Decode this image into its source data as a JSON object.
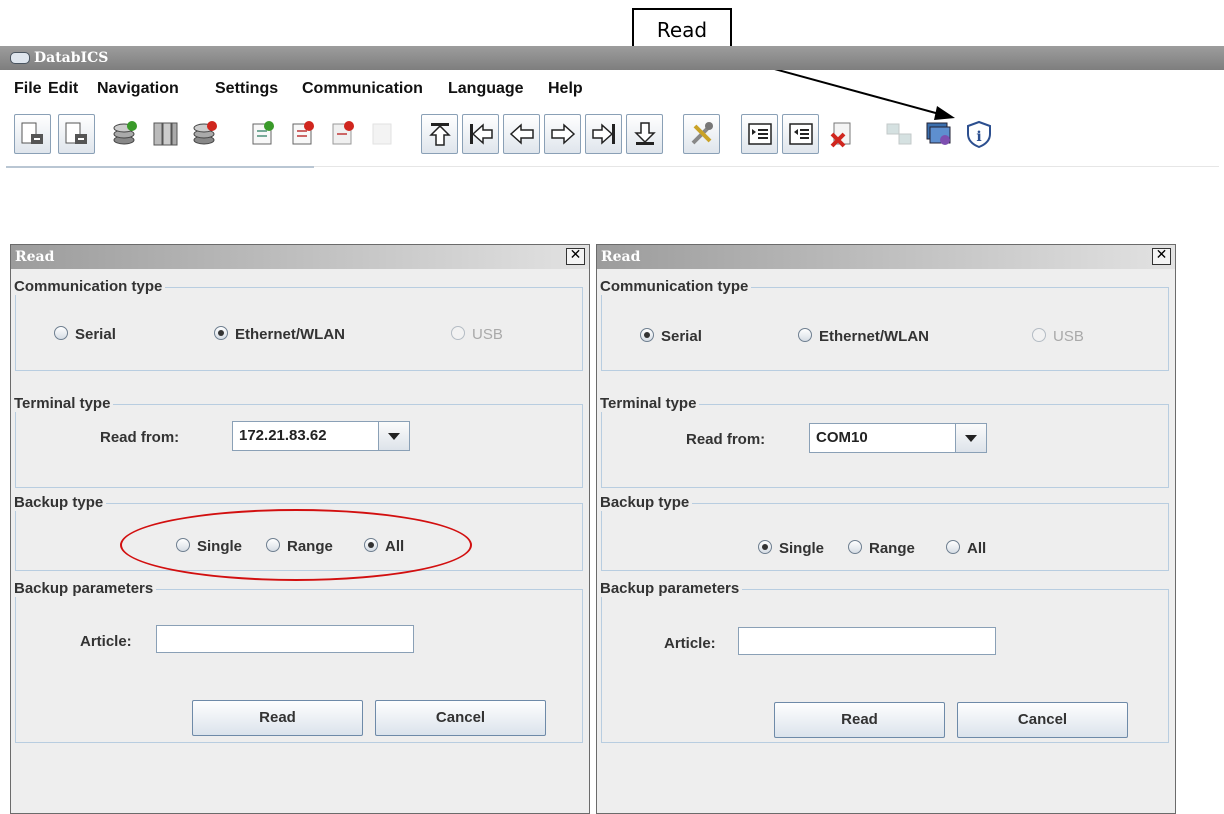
{
  "callout": {
    "text": "Read"
  },
  "app": {
    "title": "DatabICS",
    "menu": [
      "File",
      "Edit",
      "Navigation",
      "Settings",
      "Communication",
      "Language",
      "Help"
    ]
  },
  "toolbar_icons": [
    "import-icon",
    "export-icon",
    "add-database-icon",
    "database-list-icon",
    "delete-database-icon",
    "add-document-icon",
    "delete-document-icon",
    "remove-document-icon",
    "disabled-document-icon",
    "first-record-icon",
    "previous-page-icon",
    "previous-icon",
    "next-icon",
    "next-page-icon",
    "last-record-icon",
    "tools-icon",
    "write-icon",
    "read-icon",
    "delete-file-icon",
    "network-icon",
    "terminal-icon",
    "info-icon"
  ],
  "colors": {
    "highlight_oval": "#d20f0f"
  },
  "dialog_left": {
    "title": "Read",
    "close": "✕",
    "communication_type": {
      "label": "Communication type",
      "options": [
        "Serial",
        "Ethernet/WLAN",
        "USB"
      ],
      "selected": "Ethernet/WLAN"
    },
    "terminal_type": {
      "label": "Terminal type",
      "read_from_label": "Read from:",
      "value": "172.21.83.62"
    },
    "backup_type": {
      "label": "Backup type",
      "options": [
        "Single",
        "Range",
        "All"
      ],
      "selected": "All"
    },
    "backup_parameters": {
      "label": "Backup parameters",
      "article_label": "Article:",
      "article_value": ""
    },
    "buttons": {
      "read": "Read",
      "cancel": "Cancel"
    }
  },
  "dialog_right": {
    "title": "Read",
    "close": "✕",
    "communication_type": {
      "label": "Communication type",
      "options": [
        "Serial",
        "Ethernet/WLAN",
        "USB"
      ],
      "selected": "Serial"
    },
    "terminal_type": {
      "label": "Terminal type",
      "read_from_label": "Read from:",
      "value": "COM10"
    },
    "backup_type": {
      "label": "Backup type",
      "options": [
        "Single",
        "Range",
        "All"
      ],
      "selected": "Single"
    },
    "backup_parameters": {
      "label": "Backup parameters",
      "article_label": "Article:",
      "article_value": ""
    },
    "buttons": {
      "read": "Read",
      "cancel": "Cancel"
    }
  }
}
